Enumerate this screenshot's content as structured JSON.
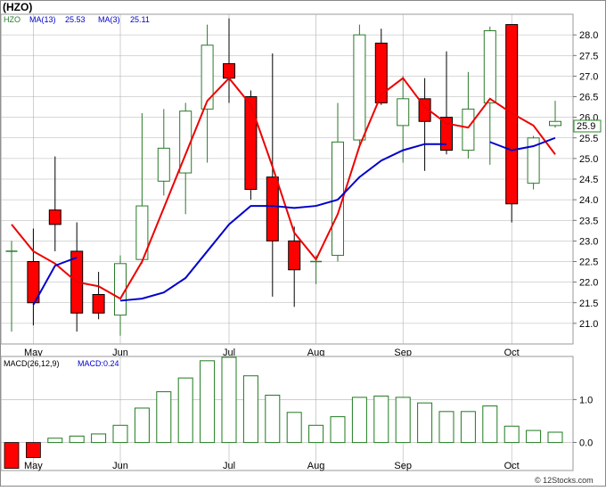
{
  "header": {
    "ticker": "(HZO)",
    "ticker_label": "HZO",
    "ma13_label": "MA(13)",
    "ma13_value": "25.53",
    "ma3_label": "MA(3)",
    "ma3_value": "25.11",
    "price_tag": "25.9",
    "macd_label": "MACD(26,12,9)",
    "macd_value_label": "MACD:0.24",
    "watermark": "© 12Stocks.com"
  },
  "colors": {
    "up_candle": "#2a7a2a",
    "down_candle": "#ff0000",
    "ma13": "#0000cc",
    "ma3": "#ee0000",
    "macd_bar": "#1f7a1f",
    "macd_neg": "#ff0000",
    "grid": "#b0b0b0",
    "price_tag_border": "#2a8a2a"
  },
  "chart_data": [
    {
      "type": "candlestick",
      "title": "HZO",
      "x_labels": [
        "May",
        "Jun",
        "Jul",
        "Aug",
        "Sep",
        "Oct"
      ],
      "x_label_index": [
        1,
        5,
        10,
        14,
        18,
        23
      ],
      "ylim": [
        20.5,
        28.5
      ],
      "y_ticks": [
        21.0,
        21.5,
        22.0,
        22.5,
        23.0,
        23.5,
        24.0,
        24.5,
        25.0,
        25.5,
        26.0,
        26.5,
        27.0,
        27.5,
        28.0
      ],
      "grid": true,
      "candles": [
        {
          "open": 22.75,
          "close": 22.75,
          "high": 23.0,
          "low": 20.8
        },
        {
          "open": 22.5,
          "close": 21.5,
          "high": 23.3,
          "low": 20.95
        },
        {
          "open": 23.75,
          "close": 23.4,
          "high": 25.05,
          "low": 22.75
        },
        {
          "open": 22.75,
          "close": 21.25,
          "high": 23.45,
          "low": 20.8
        },
        {
          "open": 21.7,
          "close": 21.25,
          "high": 22.25,
          "low": 21.1
        },
        {
          "open": 21.2,
          "close": 22.45,
          "high": 22.65,
          "low": 20.7
        },
        {
          "open": 22.55,
          "close": 23.85,
          "high": 26.1,
          "low": 22.45
        },
        {
          "open": 24.45,
          "close": 25.25,
          "high": 26.2,
          "low": 24.1
        },
        {
          "open": 24.65,
          "close": 26.15,
          "high": 26.35,
          "low": 23.65
        },
        {
          "open": 26.2,
          "close": 27.75,
          "high": 28.25,
          "low": 24.9
        },
        {
          "open": 27.3,
          "close": 26.95,
          "high": 28.4,
          "low": 26.35
        },
        {
          "open": 26.5,
          "close": 24.25,
          "high": 26.65,
          "low": 24.0
        },
        {
          "open": 24.55,
          "close": 23.0,
          "high": 27.55,
          "low": 21.65
        },
        {
          "open": 23.0,
          "close": 22.3,
          "high": 23.35,
          "low": 21.4
        },
        {
          "open": 22.5,
          "close": 22.5,
          "high": 22.65,
          "low": 21.95
        },
        {
          "open": 22.65,
          "close": 25.4,
          "high": 26.35,
          "low": 22.5
        },
        {
          "open": 25.45,
          "close": 28.0,
          "high": 28.25,
          "low": 25.35
        },
        {
          "open": 27.8,
          "close": 26.35,
          "high": 28.15,
          "low": 26.3
        },
        {
          "open": 25.8,
          "close": 26.45,
          "high": 27.0,
          "low": 24.9
        },
        {
          "open": 26.45,
          "close": 25.9,
          "high": 26.95,
          "low": 24.7
        },
        {
          "open": 26.0,
          "close": 25.2,
          "high": 27.6,
          "low": 25.1
        },
        {
          "open": 25.2,
          "close": 26.2,
          "high": 27.1,
          "low": 25.0
        },
        {
          "open": 26.35,
          "close": 28.1,
          "high": 28.2,
          "low": 24.85
        },
        {
          "open": 28.25,
          "close": 23.9,
          "high": 28.25,
          "low": 23.45
        },
        {
          "open": 24.4,
          "close": 25.5,
          "high": 25.55,
          "low": 24.25
        },
        {
          "open": 25.8,
          "close": 25.9,
          "high": 26.4,
          "low": 25.75
        }
      ],
      "ma3": [
        23.4,
        22.75,
        22.45,
        22.0,
        21.9,
        21.6,
        22.5,
        23.8,
        25.1,
        26.4,
        26.95,
        26.3,
        24.8,
        23.2,
        22.55,
        23.65,
        25.3,
        26.55,
        26.95,
        26.25,
        25.85,
        25.75,
        26.45,
        26.1,
        25.8,
        25.1
      ],
      "ma13": [
        null,
        21.45,
        22.4,
        22.6,
        null,
        21.55,
        21.6,
        21.75,
        22.1,
        22.75,
        23.4,
        23.85,
        23.85,
        23.8,
        23.85,
        24.0,
        24.55,
        24.95,
        25.2,
        25.35,
        25.35,
        null,
        25.4,
        25.2,
        25.3,
        25.5
      ]
    },
    {
      "type": "bar",
      "title": "MACD(26,12,9)",
      "ylim": [
        -0.65,
        2.0
      ],
      "y_ticks": [
        0.0,
        1.0
      ],
      "values": [
        -0.6,
        -0.35,
        0.1,
        0.15,
        0.2,
        0.4,
        0.8,
        1.18,
        1.5,
        1.9,
        1.98,
        1.55,
        1.1,
        0.7,
        0.4,
        0.6,
        1.05,
        1.08,
        1.05,
        0.92,
        0.72,
        0.72,
        0.85,
        0.38,
        0.28,
        0.24
      ]
    }
  ]
}
